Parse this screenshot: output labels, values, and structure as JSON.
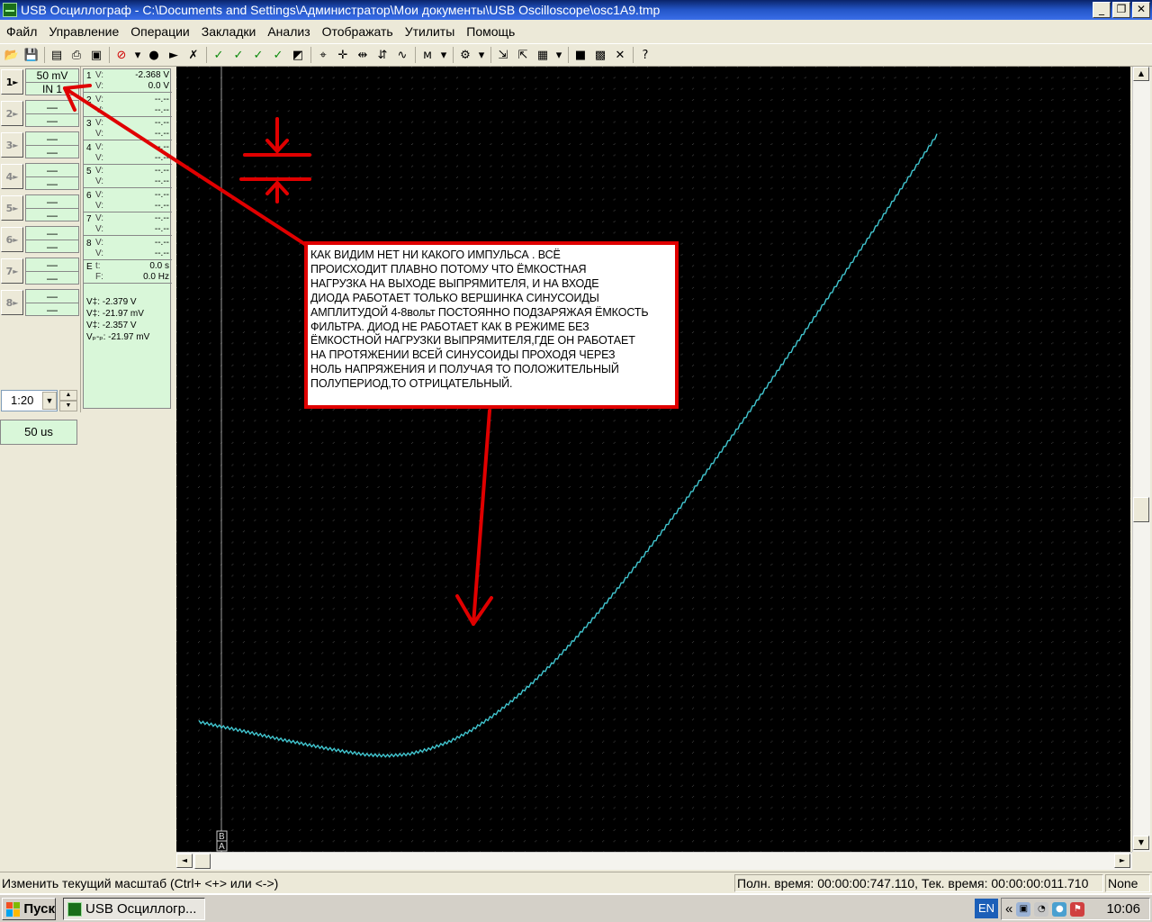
{
  "window": {
    "title": "USB Осциллограф - C:\\Documents and Settings\\Администратор\\Мои документы\\USB Oscilloscope\\osc1A9.tmp",
    "minimize": "_",
    "restore": "❐",
    "close": "✕"
  },
  "menu": [
    "Файл",
    "Управление",
    "Операции",
    "Закладки",
    "Анализ",
    "Отображать",
    "Утилиты",
    "Помощь"
  ],
  "toolbar": {
    "icons": [
      {
        "name": "open-icon",
        "glyph": "📂"
      },
      {
        "name": "save-icon",
        "glyph": "💾"
      },
      {
        "name": "save-as-icon",
        "glyph": "▤"
      },
      {
        "name": "print-icon",
        "glyph": "⎙"
      },
      {
        "name": "print-preview-icon",
        "glyph": "▣"
      },
      {
        "name": "stop-icon",
        "glyph": "⊘"
      },
      {
        "name": "dropdown-arrow-icon",
        "glyph": "▾"
      },
      {
        "name": "record-icon",
        "glyph": "●"
      },
      {
        "name": "single-icon",
        "glyph": "►"
      },
      {
        "name": "tools-icon",
        "glyph": "✗"
      },
      {
        "name": "check-icon",
        "glyph": "✓"
      },
      {
        "name": "check-v1-icon",
        "glyph": "✓"
      },
      {
        "name": "check-v2-icon",
        "glyph": "✓"
      },
      {
        "name": "check-v3-icon",
        "glyph": "✓"
      },
      {
        "name": "color-icon",
        "glyph": "◩"
      },
      {
        "name": "measure-icon",
        "glyph": "⌖"
      },
      {
        "name": "cursor-cross-icon",
        "glyph": "✛"
      },
      {
        "name": "cursor-h-icon",
        "glyph": "⇹"
      },
      {
        "name": "cursor-v-icon",
        "glyph": "⇵"
      },
      {
        "name": "cursor-wave-icon",
        "glyph": "∿"
      },
      {
        "name": "memory-icon",
        "glyph": "ᴍ"
      },
      {
        "name": "dropdown-arrow-icon",
        "glyph": "▾"
      },
      {
        "name": "channels-icon",
        "glyph": "⚙"
      },
      {
        "name": "dropdown-arrow-icon",
        "glyph": "▾"
      },
      {
        "name": "export-icon",
        "glyph": "⇲"
      },
      {
        "name": "import-icon",
        "glyph": "⇱"
      },
      {
        "name": "chart-settings-icon",
        "glyph": "▦"
      },
      {
        "name": "dropdown-arrow-icon",
        "glyph": "▾"
      },
      {
        "name": "grid-icon",
        "glyph": "■"
      },
      {
        "name": "grid-dots-icon",
        "glyph": "▩"
      },
      {
        "name": "delete-icon",
        "glyph": "✕"
      },
      {
        "name": "help-icon",
        "glyph": "?"
      }
    ]
  },
  "channels": [
    {
      "num": "1",
      "scale": "50 mV",
      "input": "IN 1",
      "active": true
    },
    {
      "num": "2",
      "scale": "—",
      "input": "—",
      "active": false
    },
    {
      "num": "3",
      "scale": "—",
      "input": "—",
      "active": false
    },
    {
      "num": "4",
      "scale": "—",
      "input": "—",
      "active": false
    },
    {
      "num": "5",
      "scale": "—",
      "input": "—",
      "active": false
    },
    {
      "num": "6",
      "scale": "—",
      "input": "—",
      "active": false
    },
    {
      "num": "7",
      "scale": "—",
      "input": "—",
      "active": false
    },
    {
      "num": "8",
      "scale": "—",
      "input": "—",
      "active": false
    }
  ],
  "zoom": {
    "value": "1:20",
    "dropdown_glyph": "▼",
    "up_glyph": "▲",
    "down_glyph": "▼"
  },
  "timebase": "50 us",
  "measurements": {
    "rows": [
      {
        "num": "1",
        "l1": "V:",
        "v1": "-2.368 V",
        "l2": "V:",
        "v2": "0.0 V"
      },
      {
        "num": "2",
        "l1": "V:",
        "v1": "--.--",
        "l2": "V:",
        "v2": "--.--"
      },
      {
        "num": "3",
        "l1": "V:",
        "v1": "--.--",
        "l2": "V:",
        "v2": "--.--"
      },
      {
        "num": "4",
        "l1": "V:",
        "v1": "--.--",
        "l2": "V:",
        "v2": "--.--"
      },
      {
        "num": "5",
        "l1": "V:",
        "v1": "--.--",
        "l2": "V:",
        "v2": "--.--"
      },
      {
        "num": "6",
        "l1": "V:",
        "v1": "--.--",
        "l2": "V:",
        "v2": "--.--"
      },
      {
        "num": "7",
        "l1": "V:",
        "v1": "--.--",
        "l2": "V:",
        "v2": "--.--"
      },
      {
        "num": "8",
        "l1": "V:",
        "v1": "--.--",
        "l2": "V:",
        "v2": "--.--"
      },
      {
        "num": "E",
        "l1": "t:",
        "v1": "0.0 s",
        "l2": "F:",
        "v2": "0.0 Hz"
      }
    ],
    "cursor": [
      "V‡: -2.379 V",
      "V‡: -21.97 mV",
      "V‡: -2.357 V",
      "Vₚ-ₚ: -21.97 mV"
    ]
  },
  "plot": {
    "background": "#000000",
    "grid_color": "#3a3a3a",
    "trace_color": "#41c5cf",
    "marker_b": "B",
    "marker_a": "A"
  },
  "chart_data": {
    "type": "line",
    "title": "",
    "xlabel": "",
    "ylabel": "",
    "grid": true,
    "x_divisions": 84,
    "y_divisions": 70,
    "series": [
      {
        "x": [
          0,
          2,
          4,
          6,
          8,
          10,
          12,
          14,
          16,
          18,
          20,
          22,
          24,
          26,
          28,
          30,
          32,
          34,
          36,
          38,
          40,
          42,
          44,
          46,
          48,
          50,
          52,
          54,
          56,
          58,
          60,
          62,
          64,
          66,
          68,
          70,
          70.5
        ],
        "y": [
          25.2,
          24.3,
          23.5,
          22.6,
          21.7,
          20.9,
          20.1,
          19.4,
          18.8,
          18.6,
          18.9,
          19.9,
          21.4,
          23.5,
          26.2,
          29.4,
          33.0,
          37.0,
          41.4,
          46.0,
          51.0,
          56.1,
          61.4,
          66.8,
          72.3,
          77.9,
          83.6,
          89.4,
          95.3,
          101.2,
          107.1,
          113.1,
          119.1,
          125.2,
          131.3,
          137.4,
          138.9
        ]
      }
    ]
  },
  "annotation": {
    "lines": [
      " КАК  ВИДИМ  НЕТ  НИ  КАКОГО  ИМПУЛЬСА .  ВСЁ",
      "ПРОИСХОДИТ  ПЛАВНО  ПОТОМУ  ЧТО  ЁМКОСТНАЯ",
      " НАГРУЗКА  НА  ВЫХОДЕ  ВЫПРЯМИТЕЛЯ, И  НА  ВХОДЕ",
      "ДИОДА РАБОТАЕТ  ТОЛЬКО  ВЕРШИНКА  СИНУСОИДЫ",
      "АМПЛИТУДОЙ  4-8вольт  ПОСТОЯННО ПОДЗАРЯЖАЯ  ЁМКОСТЬ",
      " ФИЛЬТРА.  ДИОД НЕ  РАБОТАЕТ  КАК  В  РЕЖИМЕ  БЕЗ",
      "ЁМКОСТНОЙ  НАГРУЗКИ   ВЫПРЯМИТЕЛЯ,ГДЕ  ОН  РАБОТАЕТ",
      " НА  ПРОТЯЖЕНИИ ВСЕЙ  СИНУСОИДЫ  ПРОХОДЯ  ЧЕРЕЗ",
      "НОЛЬ  НАПРЯЖЕНИЯ  И  ПОЛУЧАЯ  ТО  ПОЛОЖИТЕЛЬНЫЙ",
      "ПОЛУПЕРИОД,ТО  ОТРИЦАТЕЛЬНЫЙ."
    ],
    "color": "#e00000"
  },
  "statusbar": {
    "hint": "Изменить текущий масштаб (Ctrl+ <+> или <->)",
    "times": "Полн. время: 00:00:00:747.110, Тек. время: 00:00:00:011.710",
    "mode": "None"
  },
  "taskbar": {
    "start": "Пуск",
    "task": "USB Осциллогр...",
    "lang": "EN",
    "chevron": "«",
    "clock": "10:06"
  },
  "scroll": {
    "up": "▲",
    "down": "▼",
    "left": "◄",
    "right": "►"
  }
}
